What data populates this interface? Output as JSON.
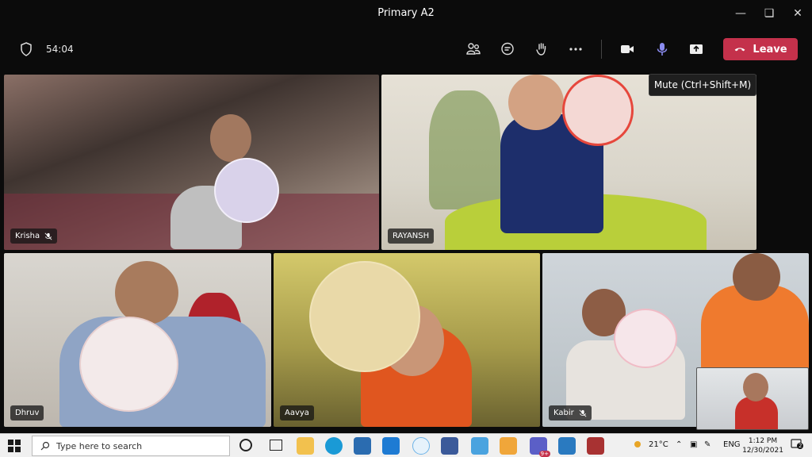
{
  "window": {
    "title": "Primary A2"
  },
  "toolbar": {
    "timer": "54:04",
    "leave_label": "Leave",
    "mute_tooltip": "Mute (Ctrl+Shift+M)"
  },
  "participants": [
    {
      "name": "Krisha"
    },
    {
      "name": "RAYANSH"
    },
    {
      "name": "Dhruv"
    },
    {
      "name": "Aavya"
    },
    {
      "name": "Kabir"
    }
  ],
  "taskbar": {
    "search_placeholder": "Type here to search",
    "weather": "21°C",
    "language": "ENG",
    "time": "1:12 PM",
    "date": "12/30/2021",
    "notifications": "2",
    "teams_badge": "9+"
  },
  "colors": {
    "leave": "#c4314b",
    "mic_active": "#8b8cf0"
  }
}
